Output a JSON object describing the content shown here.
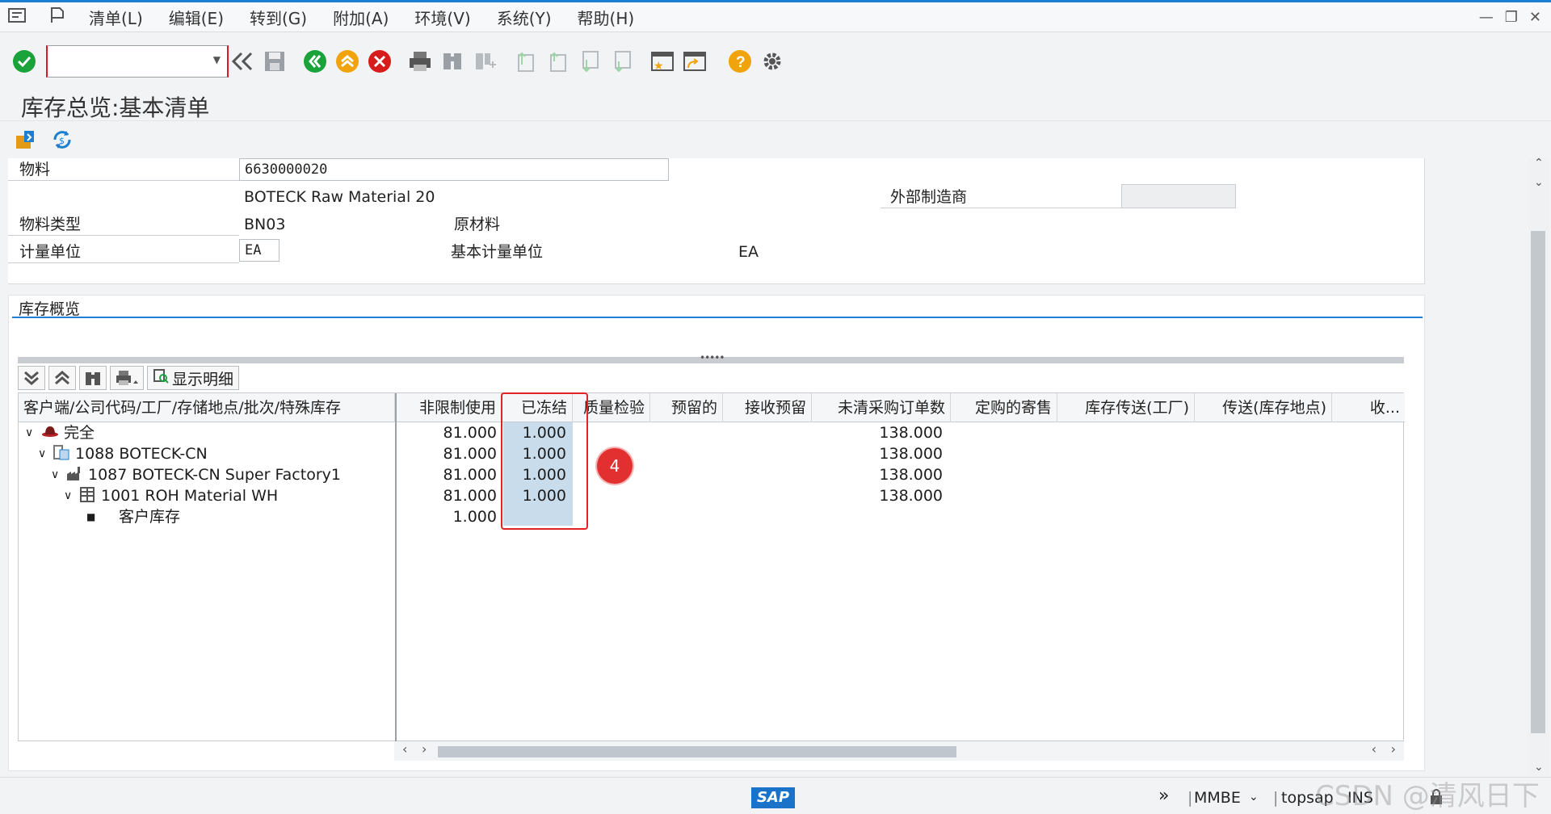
{
  "menu": {
    "items": [
      "清单(L)",
      "编辑(E)",
      "转到(G)",
      "附加(A)",
      "环境(V)",
      "系统(Y)",
      "帮助(H)"
    ]
  },
  "toolbar": {
    "command_value": "",
    "icons": [
      "enter-icon",
      "back-icon",
      "save-icon",
      "back-green-icon",
      "exit-icon",
      "cancel-icon",
      "print-icon",
      "find-icon",
      "find-next-icon",
      "first-page-icon",
      "prev-page-icon",
      "next-page-icon",
      "last-page-icon",
      "new-session-icon",
      "shortcut-icon",
      "help-icon",
      "settings-icon"
    ]
  },
  "title": "库存总览:基本清单",
  "header": {
    "material_label": "物料",
    "material_value": "6630000020",
    "material_desc": "BOTECK Raw Material 20",
    "ext_manufacturer_label": "外部制造商",
    "ext_manufacturer_value": "",
    "material_type_label": "物料类型",
    "material_type_value": "BN03",
    "material_type_desc": "原材料",
    "uom_label": "计量单位",
    "uom_value": "EA",
    "base_uom_label": "基本计量单位",
    "base_uom_value": "EA"
  },
  "overview": {
    "title": "库存概览",
    "show_detail_label": "显示明细",
    "columns": [
      "客户端/公司代码/工厂/存储地点/批次/特殊库存",
      "非限制使用",
      "已冻结",
      "质量检验",
      "预留的",
      "接收预留",
      "未清采购订单数",
      "定购的寄售",
      "库存传送(工厂)",
      "传送(库存地点)",
      "收..."
    ],
    "rows": [
      {
        "label": "完全",
        "unrestricted": "81.000",
        "blocked": "1.000",
        "open_po": "138.000"
      },
      {
        "label": "1088 BOTECK-CN",
        "unrestricted": "81.000",
        "blocked": "1.000",
        "open_po": "138.000"
      },
      {
        "label": "1087 BOTECK-CN Super Factory1",
        "unrestricted": "81.000",
        "blocked": "1.000",
        "open_po": "138.000"
      },
      {
        "label": "1001 ROH Material WH",
        "unrestricted": "81.000",
        "blocked": "1.000",
        "open_po": "138.000"
      },
      {
        "label": "客户库存",
        "unrestricted": "1.000",
        "blocked": "",
        "open_po": ""
      }
    ]
  },
  "annotation": {
    "badge": "4"
  },
  "status": {
    "transaction": "MMBE",
    "server": "topsap",
    "mode": "INS",
    "logo": "SAP"
  },
  "watermark": "CSDN @清风日下",
  "colors": {
    "accent": "#1d7fd1",
    "highlight": "#c9dcec",
    "callout": "#e02424"
  }
}
